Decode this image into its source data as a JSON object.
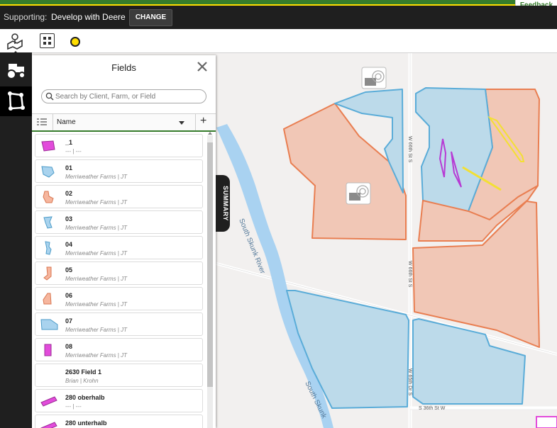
{
  "header": {
    "feedback_label": "Feedback",
    "supporting_label": "Supporting:",
    "organization": "Develop with Deere",
    "change_label": "CHANGE"
  },
  "toolbar": {
    "icons": [
      "map-layers-icon",
      "grid-icon",
      "status-dot-icon"
    ],
    "status_dot_color": "#ffde00"
  },
  "rail": {
    "items": [
      "tractor-icon",
      "field-boundary-icon"
    ]
  },
  "panel": {
    "title": "Fields",
    "search_placeholder": "Search by Client, Farm, or Field",
    "column_name": "Name",
    "add_label": "+",
    "summary_label": "SUMMARY"
  },
  "fields": [
    {
      "name": "_1",
      "sub": "--- | ---",
      "color": "#e24bdb"
    },
    {
      "name": "01",
      "sub": "Merriweather Farms | JT",
      "color": "#a9d3ee"
    },
    {
      "name": "02",
      "sub": "Merriweather Farms | JT",
      "color": "#f6b69e"
    },
    {
      "name": "03",
      "sub": "Merriweather Farms | JT",
      "color": "#a9d3ee"
    },
    {
      "name": "04",
      "sub": "Merriweather Farms | JT",
      "color": "#a9d3ee"
    },
    {
      "name": "05",
      "sub": "Merriweather Farms | JT",
      "color": "#f6b69e"
    },
    {
      "name": "06",
      "sub": "Merriweather Farms | JT",
      "color": "#f6b69e"
    },
    {
      "name": "07",
      "sub": "Merriweather Farms | JT",
      "color": "#a9d3ee"
    },
    {
      "name": "08",
      "sub": "Merriweather Farms | JT",
      "color": "#e24bdb"
    },
    {
      "name": "2630 Field 1",
      "sub": "Brian | Krohn",
      "color": ""
    },
    {
      "name": "280 oberhalb",
      "sub": "--- | ---",
      "color": "#e24bdb"
    },
    {
      "name": "280 unterhalb",
      "sub": "",
      "color": "#e24bdb"
    }
  ],
  "map": {
    "labels": {
      "river": "South Skunk River",
      "river2": "South Skunk",
      "road_a": "W 66th St S",
      "road_b": "W 66th St S",
      "road_c": "S 36th St W",
      "road_d": "W 65th Dr S"
    },
    "colors": {
      "blue_fill": "#bcdaea",
      "blue_stroke": "#5aacd8",
      "orange_fill": "#f1c7b6",
      "orange_stroke": "#e97e51",
      "water": "#a9d2f1"
    }
  }
}
